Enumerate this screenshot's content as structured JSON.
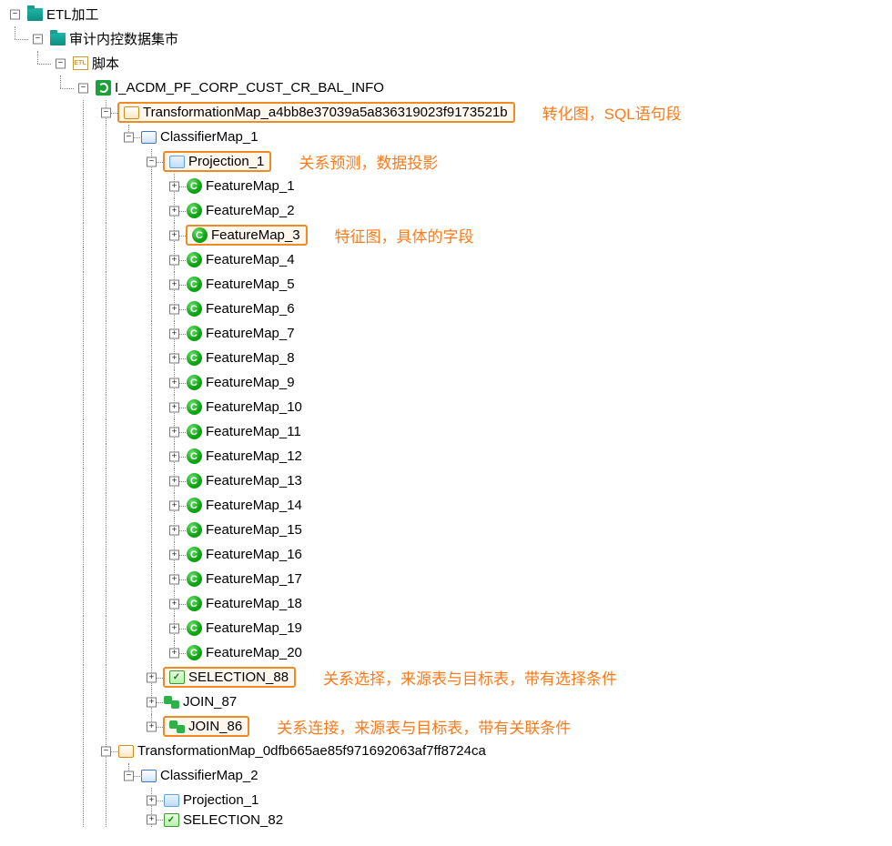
{
  "tree": {
    "root": "ETL加工",
    "lvl1": "审计内控数据集市",
    "lvl2": "脚本",
    "lvl3": "I_ACDM_PF_CORP_CUST_CR_BAL_INFO",
    "tmap1": "TransformationMap_a4bb8e37039a5a836319023f9173521b",
    "cmap1": "ClassifierMap_1",
    "proj1": "Projection_1",
    "features": [
      "FeatureMap_1",
      "FeatureMap_2",
      "FeatureMap_3",
      "FeatureMap_4",
      "FeatureMap_5",
      "FeatureMap_6",
      "FeatureMap_7",
      "FeatureMap_8",
      "FeatureMap_9",
      "FeatureMap_10",
      "FeatureMap_11",
      "FeatureMap_12",
      "FeatureMap_13",
      "FeatureMap_14",
      "FeatureMap_15",
      "FeatureMap_16",
      "FeatureMap_17",
      "FeatureMap_18",
      "FeatureMap_19",
      "FeatureMap_20"
    ],
    "sel88": "SELECTION_88",
    "join87": "JOIN_87",
    "join86": "JOIN_86",
    "tmap2": "TransformationMap_0dfb665ae85f971692063af7ff8724ca",
    "cmap2": "ClassifierMap_2",
    "proj2": "Projection_1",
    "sel82": "SELECTION_82"
  },
  "etlIconText": "ETL",
  "circleLetter": "C",
  "annot": {
    "tmap": "转化图，SQL语句段",
    "proj": "关系预测，数据投影",
    "feat": "特征图，具体的字段",
    "sel": "关系选择，来源表与目标表，带有选择条件",
    "join": "关系连接，来源表与目标表，带有关联条件"
  }
}
